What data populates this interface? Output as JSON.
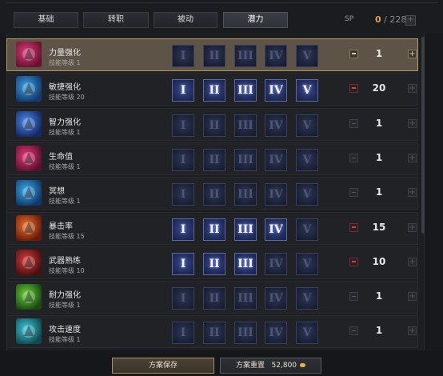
{
  "tabs": [
    {
      "label": "基础",
      "active": false
    },
    {
      "label": "转职",
      "active": false
    },
    {
      "label": "被动",
      "active": false
    },
    {
      "label": "潜力",
      "active": true
    }
  ],
  "sp": {
    "label": "SP",
    "current": "0",
    "separator": "/",
    "max": "228",
    "plus": "+"
  },
  "tiers": [
    "I",
    "II",
    "III",
    "IV",
    "V"
  ],
  "skills": [
    {
      "name": "力量强化",
      "level": "技能等级 1",
      "points": "1",
      "unlocked": 0,
      "selected": true,
      "icon": "fist-power-icon",
      "colors": [
        "#d83a7a",
        "#6a1030"
      ]
    },
    {
      "name": "敏捷强化",
      "level": "技能等级 20",
      "points": "20",
      "unlocked": 5,
      "selected": false,
      "icon": "agility-icon",
      "colors": [
        "#3aa0e0",
        "#123a70"
      ]
    },
    {
      "name": "智力强化",
      "level": "技能等级 1",
      "points": "1",
      "unlocked": 0,
      "selected": false,
      "icon": "intelligence-helm-icon",
      "colors": [
        "#4a8ae8",
        "#142a68"
      ]
    },
    {
      "name": "生命值",
      "level": "技能等级 1",
      "points": "1",
      "unlocked": 0,
      "selected": false,
      "icon": "health-potion-icon",
      "colors": [
        "#e83a7a",
        "#5a1030"
      ]
    },
    {
      "name": "冥想",
      "level": "技能等级 1",
      "points": "1",
      "unlocked": 0,
      "selected": false,
      "icon": "meditation-icon",
      "colors": [
        "#3aa8e8",
        "#103a6a"
      ]
    },
    {
      "name": "暴击率",
      "level": "技能等级 15",
      "points": "15",
      "unlocked": 4,
      "selected": false,
      "icon": "critical-rate-icon",
      "colors": [
        "#e8702a",
        "#6a1a08"
      ]
    },
    {
      "name": "武器熟练",
      "level": "技能等级 10",
      "points": "10",
      "unlocked": 3,
      "selected": false,
      "icon": "weapon-mastery-icon",
      "colors": [
        "#d83a3a",
        "#4a1010"
      ]
    },
    {
      "name": "耐力强化",
      "level": "技能等级 1",
      "points": "1",
      "unlocked": 0,
      "selected": false,
      "icon": "endurance-icon",
      "colors": [
        "#6ad03a",
        "#1a4a10"
      ]
    },
    {
      "name": "攻击速度",
      "level": "技能等级 1",
      "points": "1",
      "unlocked": 0,
      "selected": false,
      "icon": "attack-speed-icon",
      "colors": [
        "#3ac8d8",
        "#104a50"
      ]
    }
  ],
  "footer": {
    "save_label": "方案保存",
    "reset_label": "方案重置",
    "reset_cost": "52,800",
    "currency_icon": "gold-coin-icon"
  }
}
